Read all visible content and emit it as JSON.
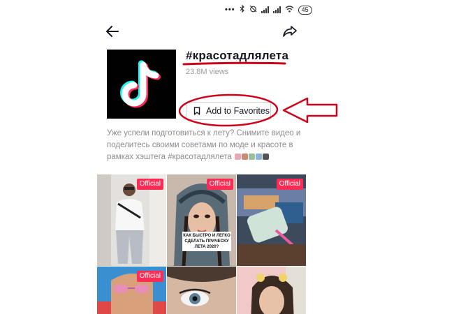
{
  "status_bar": {
    "battery": "45",
    "icons": [
      "dots-icon",
      "bluetooth-icon",
      "alarm-off-icon",
      "signal-icon",
      "signal-icon",
      "wifi-icon",
      "battery-icon"
    ]
  },
  "header": {
    "back_icon": "arrow-left-icon",
    "share_icon": "share-arrow-icon"
  },
  "hashtag": {
    "title": "#красотадлялета",
    "views": "23.8M views",
    "favorite_label": "Add to Favorites",
    "favorite_icon": "bookmark-icon",
    "description": "Уже успели подготовиться к лету? Снимите видео и поделитесь своими советами по моде и красоте в рамках хэштега #красотадлялета"
  },
  "videos": [
    {
      "badge": "Official",
      "caption": ""
    },
    {
      "badge": "Official",
      "caption": "КАК БЫСТРО И ЛЕГКО СДЕЛАТЬ ПРИЧЕСКУ ЛЕТА 2020?"
    },
    {
      "badge": "Official",
      "caption": ""
    },
    {
      "badge": "Official",
      "caption": ""
    },
    {
      "badge": "",
      "caption": ""
    },
    {
      "badge": "",
      "caption": ""
    }
  ],
  "annotations": {
    "highlight_color": "#d0021b"
  }
}
